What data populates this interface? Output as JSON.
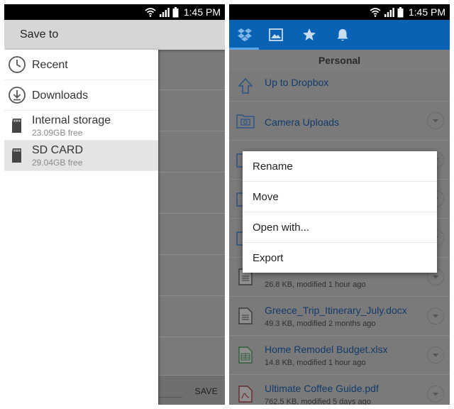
{
  "status_bar": {
    "time": "1:45 PM",
    "icons": [
      "wifi-icon",
      "signal-icon",
      "battery-icon"
    ]
  },
  "save_dialog": {
    "title": "Save to",
    "items": [
      {
        "label": "Recent",
        "icon": "clock-icon"
      },
      {
        "label": "Downloads",
        "icon": "download-icon"
      },
      {
        "label": "Internal storage",
        "sub": "23.09GB free",
        "icon": "sd-card-icon"
      },
      {
        "label": "SD CARD",
        "sub": "29.04GB free",
        "icon": "sd-card-icon",
        "selected": true
      }
    ],
    "save_label": "SAVE"
  },
  "dropbox": {
    "tabs": [
      "dropbox-icon",
      "photos-icon",
      "star-icon",
      "bell-icon"
    ],
    "section": "Personal",
    "files": [
      {
        "name": "Up to Dropbox",
        "icon": "up-arrow-icon"
      },
      {
        "name": "Camera Uploads",
        "icon": "camera-folder-icon"
      },
      {
        "name": "",
        "icon": "folder-icon"
      },
      {
        "name": "",
        "icon": "folder-icon"
      },
      {
        "name": "",
        "icon": "folder-icon"
      },
      {
        "name": "",
        "meta": "26.8 KB, modified 1 hour ago",
        "icon": "document-icon"
      },
      {
        "name": "Greece_Trip_Itinerary_July.docx",
        "meta": "49.3 KB, modified 2 months ago",
        "icon": "document-icon"
      },
      {
        "name": "Home Remodel Budget.xlsx",
        "meta": "14.8 KB, modified 1 hour ago",
        "icon": "spreadsheet-icon"
      },
      {
        "name": "Ultimate Coffee Guide.pdf",
        "meta": "762.5 KB, modified 5 days ago",
        "icon": "pdf-icon"
      }
    ],
    "menu": [
      "Rename",
      "Move",
      "Open with...",
      "Export"
    ]
  },
  "colors": {
    "dropbox_blue": "#0a62b4",
    "dim_overlay": "#7a7a7a",
    "link_text": "#123a6a"
  }
}
